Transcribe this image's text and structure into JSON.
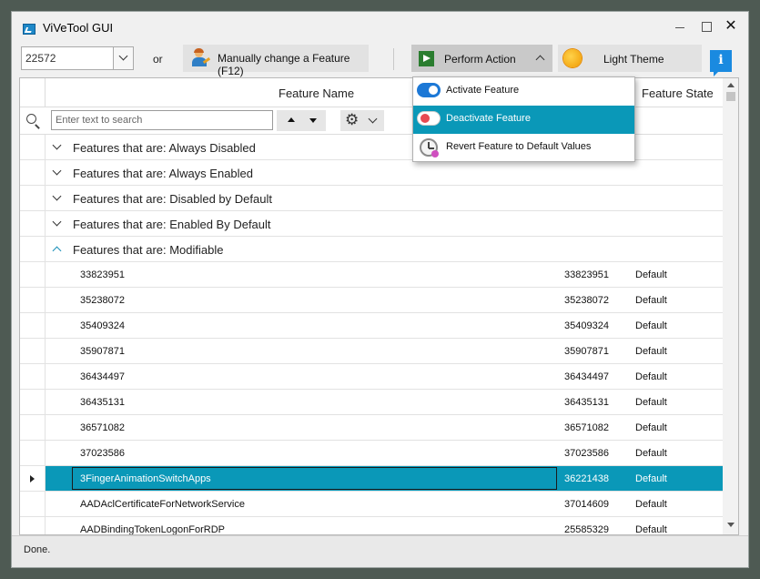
{
  "window": {
    "title": "ViVeTool GUI"
  },
  "toolbar": {
    "build_value": "22572",
    "or_label": "or",
    "manual_label": "Manually change a Feature (F12)",
    "perform_label": "Perform Action",
    "theme_label": "Light Theme"
  },
  "grid": {
    "col_name": "Feature Name",
    "col_state": "Feature State",
    "search_placeholder": "Enter text to search",
    "groups": [
      "Features that are: Always Disabled",
      "Features that are: Always Enabled",
      "Features that are: Disabled by Default",
      "Features that are: Enabled By Default",
      "Features that are: Modifiable"
    ],
    "rows": [
      {
        "name": "33823951",
        "id": "33823951",
        "state": "Default"
      },
      {
        "name": "35238072",
        "id": "35238072",
        "state": "Default"
      },
      {
        "name": "35409324",
        "id": "35409324",
        "state": "Default"
      },
      {
        "name": "35907871",
        "id": "35907871",
        "state": "Default"
      },
      {
        "name": "36434497",
        "id": "36434497",
        "state": "Default"
      },
      {
        "name": "36435131",
        "id": "36435131",
        "state": "Default"
      },
      {
        "name": "36571082",
        "id": "36571082",
        "state": "Default"
      },
      {
        "name": "37023586",
        "id": "37023586",
        "state": "Default"
      },
      {
        "name": "3FingerAnimationSwitchApps",
        "id": "36221438",
        "state": "Default"
      },
      {
        "name": "AADAclCertificateForNetworkService",
        "id": "37014609",
        "state": "Default"
      },
      {
        "name": "AADBindingTokenLogonForRDP",
        "id": "25585329",
        "state": "Default"
      }
    ]
  },
  "menu": {
    "items": [
      {
        "label": "Activate Feature"
      },
      {
        "label": "Deactivate Feature"
      },
      {
        "label": "Revert Feature to Default Values"
      }
    ]
  },
  "status": {
    "text": "Done."
  }
}
